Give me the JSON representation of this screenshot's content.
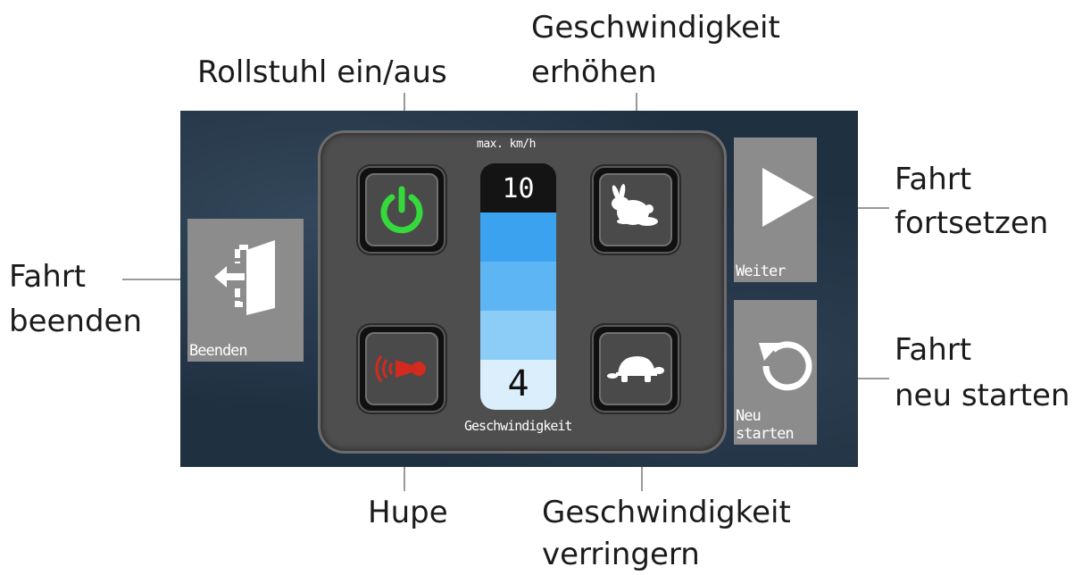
{
  "callouts": {
    "power": "Rollstuhl ein/aus",
    "speed_up": [
      "Geschwindigkeit",
      "erhöhen"
    ],
    "exit": [
      "Fahrt",
      "beenden"
    ],
    "continue": [
      "Fahrt",
      "fortsetzen"
    ],
    "restart": [
      "Fahrt",
      "neu starten"
    ],
    "horn": "Hupe",
    "speed_down": [
      "Geschwindigkeit",
      "verringern"
    ]
  },
  "screen": {
    "exit_button": {
      "label": "Beenden",
      "icon": "exit-door-icon"
    },
    "continue_button": {
      "label": "Weiter",
      "icon": "play-icon"
    },
    "restart_button": {
      "label": "Neu starten",
      "icon": "restart-icon"
    },
    "power_button": {
      "icon": "power-icon",
      "color": "#35d93b"
    },
    "horn_button": {
      "icon": "horn-icon",
      "color": "#d32a1f"
    },
    "speed_up_button": {
      "icon": "rabbit-icon"
    },
    "speed_down_button": {
      "icon": "turtle-icon"
    },
    "speed": {
      "top_label": "max. km/h",
      "max_value": "10",
      "current_value": "4",
      "bottom_label": "Geschwindigkeit"
    }
  }
}
